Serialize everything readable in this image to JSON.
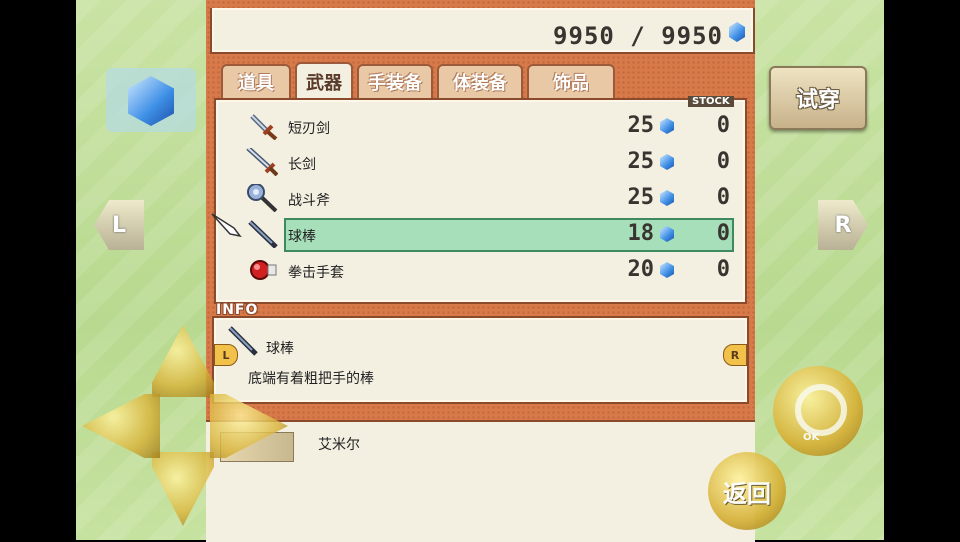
{
  "money": {
    "current": "9950",
    "separator": "/",
    "max": "9950"
  },
  "tabs": [
    {
      "label": "道具"
    },
    {
      "label": "武器"
    },
    {
      "label": "手装备"
    },
    {
      "label": "体装备"
    },
    {
      "label": "饰品"
    }
  ],
  "active_tab": 1,
  "try_on_label": "试穿",
  "stock_header": "STOCK",
  "items": [
    {
      "name": "短刃剑",
      "price": "25",
      "stock": "0",
      "icon": "dagger-icon"
    },
    {
      "name": "长剑",
      "price": "25",
      "stock": "0",
      "icon": "sword-icon"
    },
    {
      "name": "战斗斧",
      "price": "25",
      "stock": "0",
      "icon": "axe-icon"
    },
    {
      "name": "球棒",
      "price": "18",
      "stock": "0",
      "icon": "bat-icon"
    },
    {
      "name": "拳击手套",
      "price": "20",
      "stock": "0",
      "icon": "glove-icon"
    }
  ],
  "selected_index": 3,
  "info": {
    "tag": "INFO",
    "name": "球棒",
    "description": "底端有着粗把手的棒",
    "prev": "L",
    "next": "R"
  },
  "character": {
    "name": "艾米尔"
  },
  "controls": {
    "l": "L",
    "r": "R",
    "ok": "OK",
    "back": "返回"
  },
  "colors": {
    "frame": "#d8794a",
    "panel": "#f3efe1",
    "highlight": "#a6dfba",
    "side": "#c9e3a4"
  }
}
